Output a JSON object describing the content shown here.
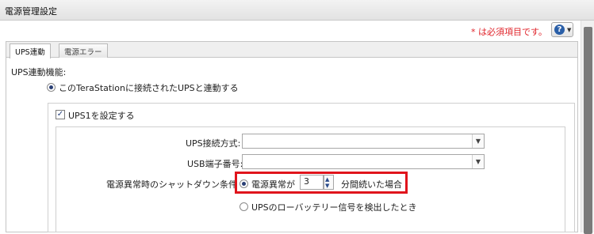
{
  "window": {
    "title": "電源管理設定"
  },
  "header": {
    "required_note": "* は必須項目です。",
    "help_icon": "question-circle-icon"
  },
  "tabs": [
    {
      "label": "UPS連動",
      "active": true
    },
    {
      "label": "電源エラー",
      "active": false
    }
  ],
  "form": {
    "ups_link_label": "UPS連動機能:",
    "ups_link_option": "このTeraStationに接続されたUPSと連動する",
    "ups1_checkbox_label": "UPS1を設定する",
    "ups1_checked": true,
    "connection_method_label": "UPS接続方式:",
    "connection_method_value": "",
    "usb_port_label": "USB端子番号:",
    "usb_port_value": "",
    "shutdown_condition_label": "電源異常時のシャットダウン条件",
    "power_fail_option": "電源異常が",
    "minutes_value": "3",
    "minutes_suffix": "分間続いた場合",
    "low_battery_option": "UPSのローバッテリー信号を検出したとき"
  },
  "colors": {
    "required": "#e0232a",
    "highlight": "#e0141c",
    "accent": "#2a5fa8"
  }
}
